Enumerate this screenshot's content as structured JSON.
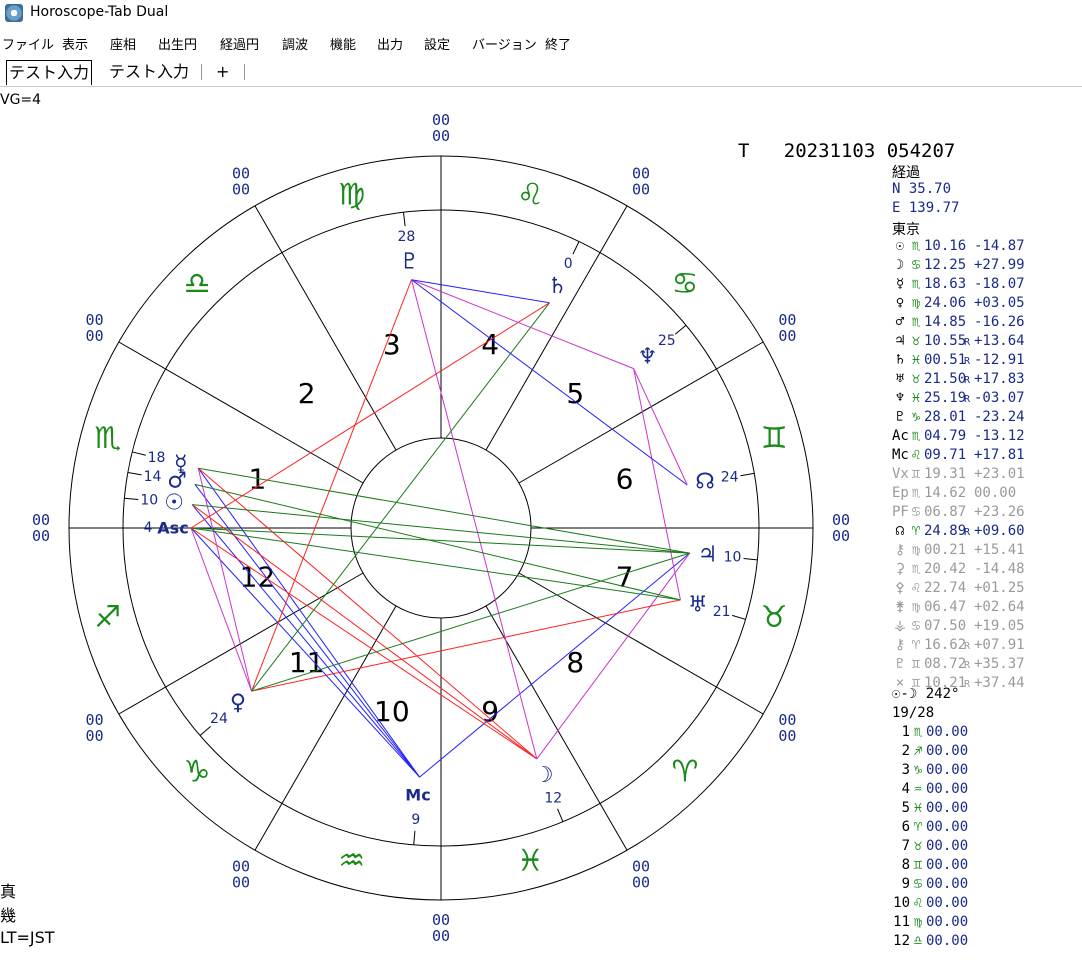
{
  "window": {
    "title": "Horoscope-Tab Dual"
  },
  "menu": [
    "ファイル",
    "表示",
    "座相",
    "出生円",
    "経過円",
    "調波",
    "機能",
    "出力",
    "設定",
    "バージョン",
    "終了"
  ],
  "tabs": [
    {
      "label": "テスト入力",
      "active": true
    },
    {
      "label": "テスト入力",
      "active": false
    }
  ],
  "tab_add": "+",
  "vg_label": "VG=4",
  "header_line": "T   20231103 054207",
  "location": {
    "mode": "経過",
    "lat": "N  35.70",
    "lon": "E 139.77",
    "place": "東京"
  },
  "ring_marks": [
    "00",
    "00"
  ],
  "planets": [
    {
      "sym": "☉",
      "sign": "♏",
      "deg": "10.16",
      "r": "",
      "lat": "-14.87",
      "muted": false
    },
    {
      "sym": "☽",
      "sign": "♋",
      "deg": "12.25",
      "r": "",
      "lat": "+27.99",
      "muted": false
    },
    {
      "sym": "☿",
      "sign": "♏",
      "deg": "18.63",
      "r": "",
      "lat": "-18.07",
      "muted": false
    },
    {
      "sym": "♀",
      "sign": "♍",
      "deg": "24.06",
      "r": "",
      "lat": "+03.05",
      "muted": false
    },
    {
      "sym": "♂",
      "sign": "♏",
      "deg": "14.85",
      "r": "",
      "lat": "-16.26",
      "muted": false
    },
    {
      "sym": "♃",
      "sign": "♉",
      "deg": "10.55",
      "r": "R",
      "lat": "+13.64",
      "muted": false
    },
    {
      "sym": "♄",
      "sign": "♓",
      "deg": "00.51",
      "r": "R",
      "lat": "-12.91",
      "muted": false
    },
    {
      "sym": "♅",
      "sign": "♉",
      "deg": "21.50",
      "r": "R",
      "lat": "+17.83",
      "muted": false
    },
    {
      "sym": "♆",
      "sign": "♓",
      "deg": "25.19",
      "r": "R",
      "lat": "-03.07",
      "muted": false
    },
    {
      "sym": "♇",
      "sign": "♑",
      "deg": "28.01",
      "r": "",
      "lat": "-23.24",
      "muted": false
    },
    {
      "sym": "Ac",
      "sign": "♏",
      "deg": "04.79",
      "r": "",
      "lat": "-13.12",
      "muted": false
    },
    {
      "sym": "Mc",
      "sign": "♌",
      "deg": "09.71",
      "r": "",
      "lat": "+17.81",
      "muted": false
    },
    {
      "sym": "Vx",
      "sign": "♊",
      "deg": "19.31",
      "r": "",
      "lat": "+23.01",
      "muted": true
    },
    {
      "sym": "Ep",
      "sign": "♏",
      "deg": "14.62",
      "r": "",
      "lat": " 00.00",
      "muted": true
    },
    {
      "sym": "PF",
      "sign": "♋",
      "deg": "06.87",
      "r": "",
      "lat": "+23.26",
      "muted": true
    },
    {
      "sym": "☊",
      "sign": "♈",
      "deg": "24.89",
      "r": "R",
      "lat": "+09.60",
      "muted": false
    },
    {
      "sym": "⚷",
      "sign": "♍",
      "deg": "00.21",
      "r": "",
      "lat": "+15.41",
      "muted": true
    },
    {
      "sym": "⚳",
      "sign": "♏",
      "deg": "20.42",
      "r": "",
      "lat": "-14.48",
      "muted": true
    },
    {
      "sym": "⚴",
      "sign": "♌",
      "deg": "22.74",
      "r": "",
      "lat": "+01.25",
      "muted": true
    },
    {
      "sym": "⚵",
      "sign": "♍",
      "deg": "06.47",
      "r": "",
      "lat": "+02.64",
      "muted": true
    },
    {
      "sym": "⚶",
      "sign": "♋",
      "deg": "07.50",
      "r": "",
      "lat": "+19.05",
      "muted": true
    },
    {
      "sym": "⚷",
      "sign": "♈",
      "deg": "16.62",
      "r": "R",
      "lat": "+07.91",
      "muted": true
    },
    {
      "sym": "♇",
      "sign": "♊",
      "deg": "08.72",
      "r": "R",
      "lat": "+35.37",
      "muted": true
    },
    {
      "sym": "×",
      "sign": "♊",
      "deg": "10.21",
      "r": "R",
      "lat": "+37.44",
      "muted": true
    }
  ],
  "sun_moon": {
    "sym": "☉-☽",
    "value": "242°"
  },
  "ratio": "19/28",
  "cusps": [
    {
      "num": "1",
      "sign": "♏",
      "val": "00.00"
    },
    {
      "num": "2",
      "sign": "♐",
      "val": "00.00"
    },
    {
      "num": "3",
      "sign": "♑",
      "val": "00.00"
    },
    {
      "num": "4",
      "sign": "♒",
      "val": "00.00"
    },
    {
      "num": "5",
      "sign": "♓",
      "val": "00.00"
    },
    {
      "num": "6",
      "sign": "♈",
      "val": "00.00"
    },
    {
      "num": "7",
      "sign": "♉",
      "val": "00.00"
    },
    {
      "num": "8",
      "sign": "♊",
      "val": "00.00"
    },
    {
      "num": "9",
      "sign": "♋",
      "val": "00.00"
    },
    {
      "num": "10",
      "sign": "♌",
      "val": "00.00"
    },
    {
      "num": "11",
      "sign": "♍",
      "val": "00.00"
    },
    {
      "num": "12",
      "sign": "♎",
      "val": "00.00"
    }
  ],
  "left_info": [
    "真",
    "幾",
    "LT=JST"
  ],
  "house_numbers": [
    "1",
    "2",
    "3",
    "4",
    "5",
    "6",
    "7",
    "8",
    "9",
    "10",
    "11",
    "12"
  ],
  "zodiac_ring": [
    {
      "name": "scorpio",
      "glyph": "♏"
    },
    {
      "name": "libra",
      "glyph": "♎"
    },
    {
      "name": "virgo",
      "glyph": "♍"
    },
    {
      "name": "leo",
      "glyph": "♌"
    },
    {
      "name": "cancer",
      "glyph": "♋"
    },
    {
      "name": "gemini",
      "glyph": "♊"
    },
    {
      "name": "taurus",
      "glyph": "♉"
    },
    {
      "name": "aries",
      "glyph": "♈"
    },
    {
      "name": "pisces",
      "glyph": "♓"
    },
    {
      "name": "aquarius",
      "glyph": "♒"
    },
    {
      "name": "capricorn",
      "glyph": "♑"
    },
    {
      "name": "sagittarius",
      "glyph": "♐"
    }
  ],
  "chart_planets": [
    {
      "name": "mc",
      "glyph": "Mc",
      "deg": "9",
      "lon": 129.71
    },
    {
      "name": "moon",
      "glyph": "☽",
      "deg": "12",
      "lon": 102.25
    },
    {
      "name": "venus",
      "glyph": "♀",
      "deg": "24",
      "lon": 174.06
    },
    {
      "name": "uranus",
      "glyph": "♅",
      "deg": "21",
      "lon": 51.5
    },
    {
      "name": "jupiter",
      "glyph": "♃",
      "deg": "10",
      "lon": 40.55
    },
    {
      "name": "asc",
      "glyph": "Asc",
      "deg": "4",
      "lon": 214.79
    },
    {
      "name": "sun",
      "glyph": "☉",
      "deg": "10",
      "lon": 220.16
    },
    {
      "name": "mars",
      "glyph": "♂",
      "deg": "14",
      "lon": 224.85
    },
    {
      "name": "mercury",
      "glyph": "☿",
      "deg": "18",
      "lon": 228.63
    },
    {
      "name": "node",
      "glyph": "☊",
      "deg": "24",
      "lon": 24.89
    },
    {
      "name": "neptune",
      "glyph": "♆",
      "deg": "25",
      "lon": 355.19
    },
    {
      "name": "saturn",
      "glyph": "♄",
      "deg": "0",
      "lon": 330.51
    },
    {
      "name": "pluto",
      "glyph": "♇",
      "deg": "28",
      "lon": 298.01
    }
  ],
  "aspect_lines": [
    {
      "from": "mc",
      "to": "asc",
      "color": "#2020ff"
    },
    {
      "from": "mc",
      "to": "sun",
      "color": "#2020ff"
    },
    {
      "from": "mc",
      "to": "mars",
      "color": "#2020ff"
    },
    {
      "from": "mc",
      "to": "mercury",
      "color": "#2020ff"
    },
    {
      "from": "mc",
      "to": "jupiter",
      "color": "#2020ff"
    },
    {
      "from": "moon",
      "to": "asc",
      "color": "#ff2020"
    },
    {
      "from": "moon",
      "to": "sun",
      "color": "#ff2020"
    },
    {
      "from": "moon",
      "to": "mercury",
      "color": "#ff2020"
    },
    {
      "from": "moon",
      "to": "pluto",
      "color": "#cc33cc"
    },
    {
      "from": "moon",
      "to": "jupiter",
      "color": "#cc33cc"
    },
    {
      "from": "venus",
      "to": "uranus",
      "color": "#ff2020"
    },
    {
      "from": "venus",
      "to": "jupiter",
      "color": "#1a7a1a"
    },
    {
      "from": "venus",
      "to": "asc",
      "color": "#cc33cc"
    },
    {
      "from": "venus",
      "to": "mercury",
      "color": "#cc33cc"
    },
    {
      "from": "venus",
      "to": "pluto",
      "color": "#ff2020"
    },
    {
      "from": "venus",
      "to": "saturn",
      "color": "#1a7a1a"
    },
    {
      "from": "uranus",
      "to": "asc",
      "color": "#1a7a1a"
    },
    {
      "from": "uranus",
      "to": "mars",
      "color": "#1a7a1a"
    },
    {
      "from": "uranus",
      "to": "neptune",
      "color": "#cc33cc"
    },
    {
      "from": "jupiter",
      "to": "sun",
      "color": "#1a7a1a"
    },
    {
      "from": "jupiter",
      "to": "mercury",
      "color": "#1a7a1a"
    },
    {
      "from": "jupiter",
      "to": "asc",
      "color": "#1a7a1a"
    },
    {
      "from": "asc",
      "to": "saturn",
      "color": "#ff2020"
    },
    {
      "from": "node",
      "to": "pluto",
      "color": "#2020ff"
    },
    {
      "from": "node",
      "to": "neptune",
      "color": "#cc33cc"
    },
    {
      "from": "neptune",
      "to": "pluto",
      "color": "#cc33cc"
    },
    {
      "from": "saturn",
      "to": "pluto",
      "color": "#2020ff"
    }
  ]
}
